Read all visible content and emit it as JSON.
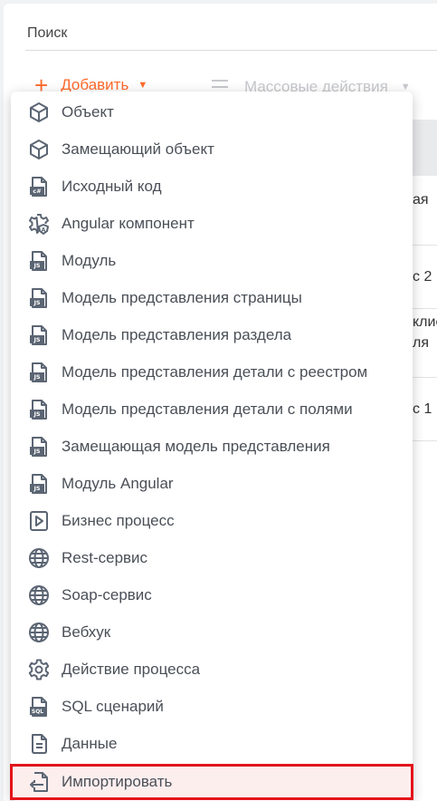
{
  "search": {
    "placeholder": "Поиск"
  },
  "toolbar": {
    "add_label": "Добавить",
    "mass_label": "Массовые действия"
  },
  "background_rows": [
    "ая",
    "с 2",
    "клие",
    "ля",
    "с 1"
  ],
  "menu": {
    "items": [
      {
        "label": "Объект",
        "icon": "cube-icon"
      },
      {
        "label": "Замещающий объект",
        "icon": "cube-icon"
      },
      {
        "label": "Исходный код",
        "icon": "csharp-file-icon"
      },
      {
        "label": "Angular компонент",
        "icon": "angular-gear-icon"
      },
      {
        "label": "Модуль",
        "icon": "js-file-icon"
      },
      {
        "label": "Модель представления страницы",
        "icon": "js-file-icon"
      },
      {
        "label": "Модель представления раздела",
        "icon": "js-file-icon"
      },
      {
        "label": "Модель представления детали с реестром",
        "icon": "js-file-icon"
      },
      {
        "label": "Модель представления детали с полями",
        "icon": "js-file-icon"
      },
      {
        "label": "Замещающая модель представления",
        "icon": "js-file-icon"
      },
      {
        "label": "Модуль Angular",
        "icon": "js-file-icon"
      },
      {
        "label": "Бизнес процесс",
        "icon": "play-file-icon"
      },
      {
        "label": "Rest-сервис",
        "icon": "globe-icon"
      },
      {
        "label": "Soap-сервис",
        "icon": "globe-icon"
      },
      {
        "label": "Вебхук",
        "icon": "globe-icon"
      },
      {
        "label": "Действие процесса",
        "icon": "gear-icon"
      },
      {
        "label": "SQL сценарий",
        "icon": "sql-file-icon"
      },
      {
        "label": "Данные",
        "icon": "data-file-icon"
      },
      {
        "label": "Импортировать",
        "icon": "import-icon",
        "highlighted": true
      }
    ]
  },
  "colors": {
    "accent": "#ff6a2b",
    "icon": "#5b6573",
    "highlight_border": "#e4141a",
    "highlight_bg": "#fdeeee"
  }
}
